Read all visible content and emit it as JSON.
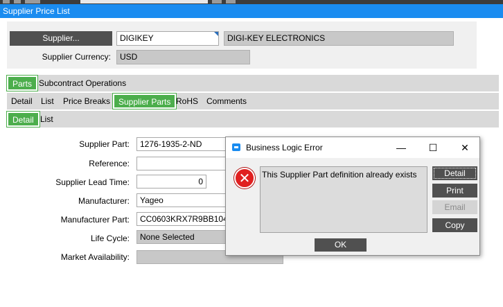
{
  "window": {
    "title": "Supplier Price List"
  },
  "header": {
    "supplier_button": "Supplier...",
    "supplier_code": "DIGIKEY",
    "supplier_name": "DIGI-KEY ELECTRONICS",
    "currency_label": "Supplier Currency:",
    "currency_value": "USD"
  },
  "tabs_main": [
    {
      "label": "Parts",
      "active": true
    },
    {
      "label": "Subcontract Operations",
      "active": false
    }
  ],
  "tabs_parts": [
    {
      "label": "Detail",
      "active": false
    },
    {
      "label": "List",
      "active": false
    },
    {
      "label": "Price Breaks",
      "active": false
    },
    {
      "label": "Supplier Parts",
      "active": true
    },
    {
      "label": "RoHS",
      "active": false
    },
    {
      "label": "Comments",
      "active": false
    }
  ],
  "tabs_supplier_parts": [
    {
      "label": "Detail",
      "active": true
    },
    {
      "label": "List",
      "active": false
    }
  ],
  "form": {
    "supplier_part": {
      "label": "Supplier Part:",
      "value": "1276-1935-2-ND"
    },
    "reference": {
      "label": "Reference:",
      "value": ""
    },
    "lead_time": {
      "label": "Supplier Lead Time:",
      "value": "0"
    },
    "manufacturer": {
      "label": "Manufacturer:",
      "value": "Yageo"
    },
    "manufacturer_part": {
      "label": "Manufacturer Part:",
      "value": "CC0603KRX7R9BB104"
    },
    "life_cycle": {
      "label": "Life Cycle:",
      "value": "None Selected"
    },
    "market_availability": {
      "label": "Market Availability:",
      "value": ""
    }
  },
  "dialog": {
    "title": "Business Logic Error",
    "message": "This Supplier Part definition already exists",
    "buttons": {
      "detail": "Detail",
      "print": "Print",
      "email": "Email",
      "copy": "Copy",
      "ok": "OK"
    },
    "controls": {
      "minimize": "—",
      "maximize": "☐",
      "close": "✕"
    },
    "error_glyph": "✕"
  },
  "colors": {
    "title_bar": "#1a8cf0",
    "tab_active": "#4cae4c",
    "button_dark": "#505050",
    "error_red": "#e02020"
  }
}
